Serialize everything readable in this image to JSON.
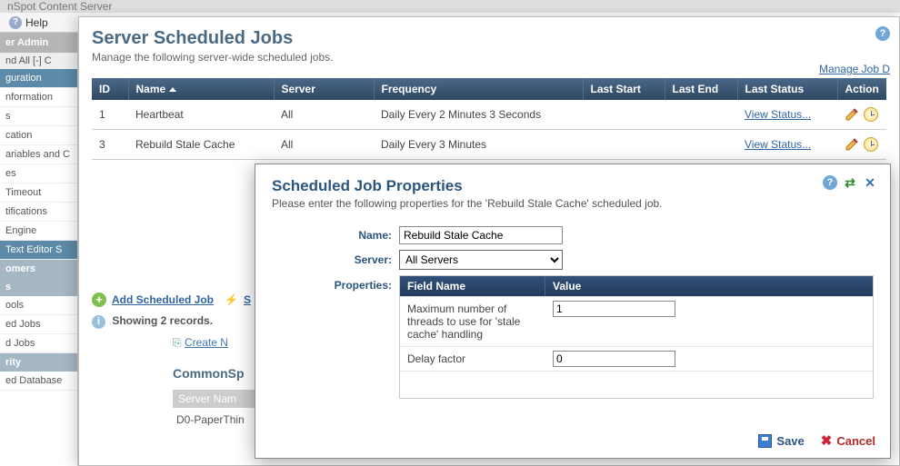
{
  "topbar": {
    "brand": "nSpot  Content Server"
  },
  "help": {
    "label": "Help"
  },
  "leftnav": {
    "header": "er Admin",
    "filter": "nd All   [-] C",
    "items": [
      "guration",
      "nformation",
      "s",
      "cation",
      "ariables and C",
      "es",
      "Timeout",
      "tifications",
      "Engine",
      "Text Editor S"
    ],
    "sect1": "omers",
    "sect2": "s",
    "items2": [
      "ools",
      "ed Jobs",
      "d Jobs"
    ],
    "sect3": "rity",
    "items3": [
      "ed Database"
    ]
  },
  "page": {
    "title": "Server Scheduled Jobs",
    "subtitle": "Manage the following server-wide scheduled jobs.",
    "manage_link": "Manage Job D"
  },
  "grid": {
    "headers": {
      "id": "ID",
      "name": "Name",
      "server": "Server",
      "frequency": "Frequency",
      "last_start": "Last Start",
      "last_end": "Last End",
      "last_status": "Last Status",
      "actions": "Action"
    },
    "rows": [
      {
        "id": "1",
        "name": "Heartbeat",
        "server": "All",
        "frequency": "Daily Every 2 Minutes 3 Seconds",
        "last_start": "",
        "last_end": "",
        "last_status": "View Status..."
      },
      {
        "id": "3",
        "name": "Rebuild Stale Cache",
        "server": "All",
        "frequency": "Daily Every 3 Minutes",
        "last_start": "",
        "last_end": "",
        "last_status": "View Status..."
      }
    ]
  },
  "below": {
    "add": "Add Scheduled Job",
    "showing": "Showing 2 records."
  },
  "bgfrag": {
    "create": "Create N",
    "common": "CommonSp",
    "srvname": "Server Nam",
    "val": "D0-PaperThin"
  },
  "modal": {
    "title": "Scheduled Job Properties",
    "subtitle_prefix": "Please enter the following properties for the '",
    "subtitle_job": "Rebuild Stale Cache",
    "subtitle_suffix": "' scheduled job.",
    "labels": {
      "name": "Name:",
      "server": "Server:",
      "properties": "Properties:"
    },
    "name_value": "Rebuild Stale Cache",
    "server_value": "All Servers",
    "prop_headers": {
      "field": "Field Name",
      "value": "Value"
    },
    "props": [
      {
        "field": "Maximum number of threads to use for 'stale cache' handling",
        "value": "1"
      },
      {
        "field": "Delay factor",
        "value": "0"
      }
    ],
    "save": "Save",
    "cancel": "Cancel"
  }
}
